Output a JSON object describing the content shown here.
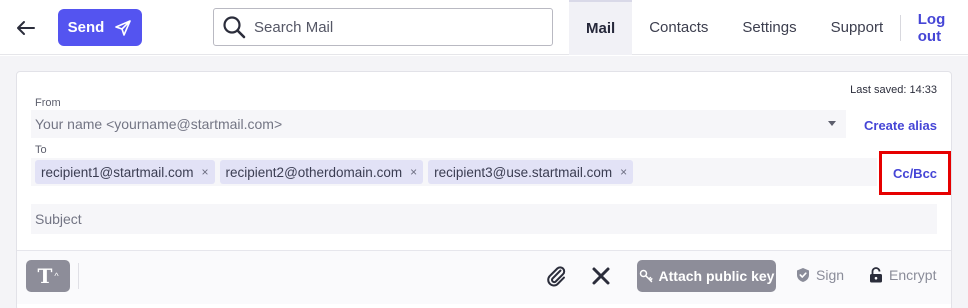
{
  "topbar": {
    "back_icon": "arrow-left-icon",
    "send_label": "Send",
    "send_icon": "paper-plane-icon",
    "search": {
      "placeholder": "Search Mail",
      "value": ""
    },
    "nav": {
      "mail": "Mail",
      "contacts": "Contacts",
      "settings": "Settings",
      "support": "Support",
      "logout": "Log out"
    }
  },
  "compose": {
    "last_saved": "Last saved: 14:33",
    "from": {
      "label": "From",
      "value": "Your name <yourname@startmail.com>",
      "create_alias": "Create alias"
    },
    "to": {
      "label": "To",
      "recipients": [
        {
          "email": "recipient1@startmail.com",
          "remove": "×"
        },
        {
          "email": "recipient2@otherdomain.com",
          "remove": "×"
        },
        {
          "email": "recipient3@use.startmail.com",
          "remove": "×"
        }
      ],
      "cc_bcc": "Cc/Bcc"
    },
    "subject": {
      "placeholder": "Subject",
      "value": ""
    },
    "toolbar": {
      "format_glyph": "T",
      "format_caret": "^",
      "attach_public_key": "Attach public key",
      "sign": "Sign",
      "encrypt": "Encrypt"
    }
  },
  "colors": {
    "accent": "#5454f0",
    "link": "#4545d6",
    "highlight_border": "#e60000",
    "chip_bg": "#e2e2f6",
    "toolbar_button": "#8d8d99"
  }
}
